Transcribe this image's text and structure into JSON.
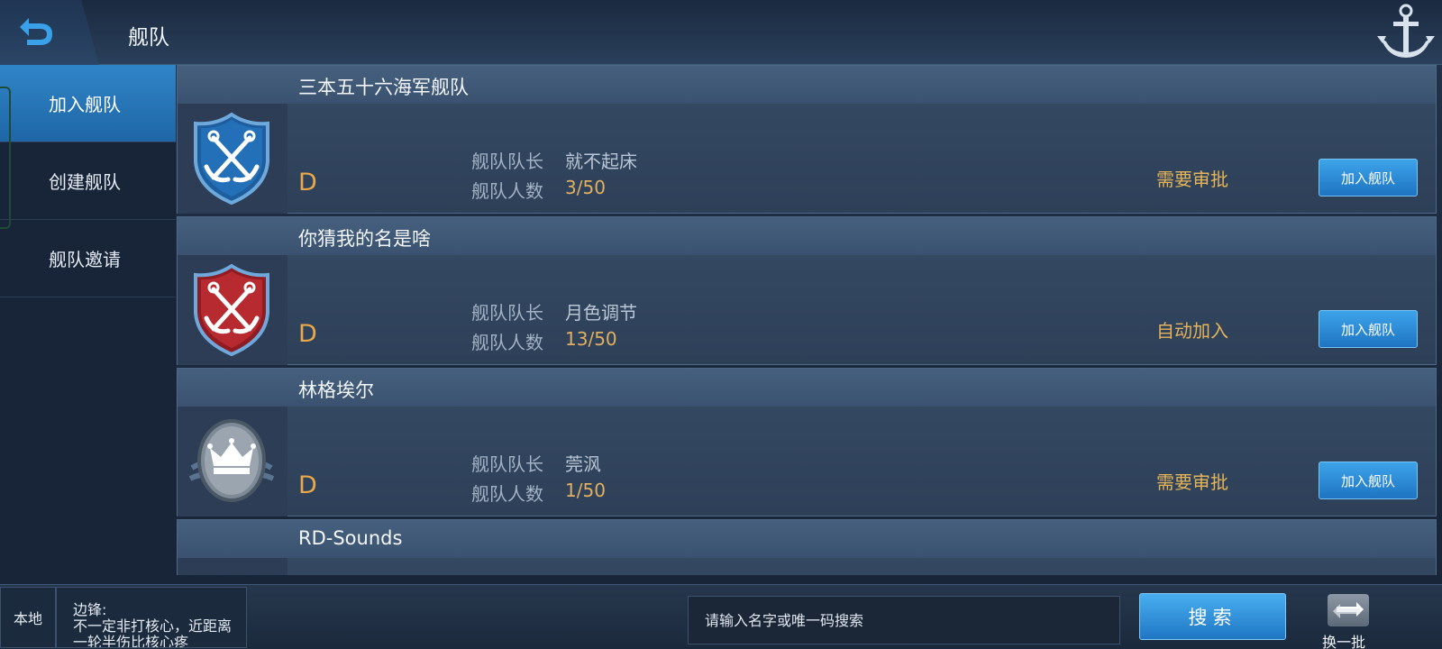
{
  "header": {
    "title": "舰队"
  },
  "sidebar": {
    "items": [
      {
        "label": "加入舰队",
        "active": true
      },
      {
        "label": "创建舰队",
        "active": false
      },
      {
        "label": "舰队邀请",
        "active": false
      }
    ]
  },
  "fleets": [
    {
      "name": "三本五十六海军舰队",
      "emblem": "anchors-blue-shield-icon",
      "grade": "D",
      "leader_label": "舰队队长",
      "leader": "就不起床",
      "count_label": "舰队人数",
      "count": "3/50",
      "policy": "需要审批",
      "join_label": "加入舰队"
    },
    {
      "name": "你猜我的名是啥",
      "emblem": "anchors-red-shield-icon",
      "grade": "D",
      "leader_label": "舰队队长",
      "leader": "月色调节",
      "count_label": "舰队人数",
      "count": "13/50",
      "policy": "自动加入",
      "join_label": "加入舰队"
    },
    {
      "name": "林格埃尔",
      "emblem": "crown-grey-badge-icon",
      "grade": "D",
      "leader_label": "舰队队长",
      "leader": "莞沨",
      "count_label": "舰队人数",
      "count": "1/50",
      "policy": "需要审批",
      "join_label": "加入舰队"
    },
    {
      "name": "RD-Sounds"
    }
  ],
  "bottom": {
    "local_label": "本地",
    "chat_text": "边锋:\n不一定非打核心，近距离一轮半伤比核心疼",
    "search_placeholder": "请输入名字或唯一码搜索",
    "search_label": "搜索",
    "refresh_label": "换一批"
  },
  "colors": {
    "accent_blue": "#2f85c8",
    "policy_gold": "#e3b45a",
    "grade_orange": "#e8a84b"
  }
}
